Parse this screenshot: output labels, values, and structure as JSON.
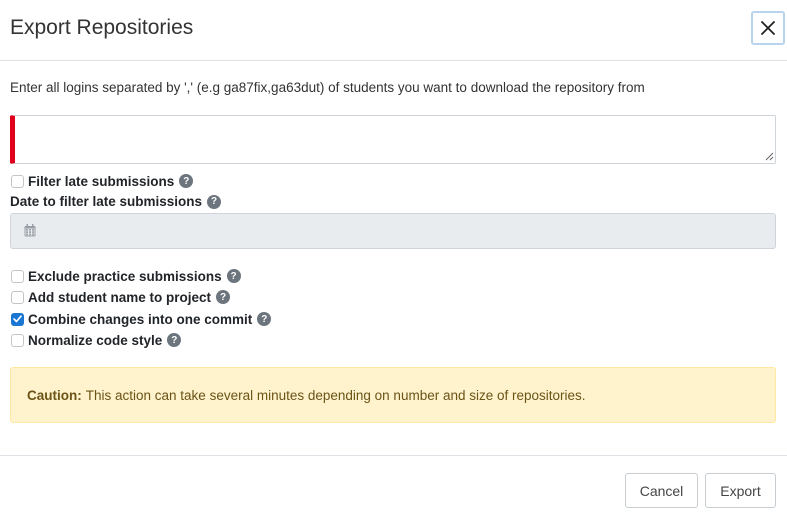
{
  "modal": {
    "title": "Export Repositories",
    "close_icon": "close-icon"
  },
  "form": {
    "hint": "Enter all logins separated by ',' (e.g ga87fix,ga63dut) of students you want to download the repository from",
    "logins_value": "",
    "filter_late": {
      "label": "Filter late submissions",
      "checked": false
    },
    "date_label": "Date to filter late submissions",
    "date_value": "",
    "date_icon": "calendar-icon",
    "help_icon": "question-circle-icon",
    "options": [
      {
        "label": "Exclude practice submissions",
        "checked": false
      },
      {
        "label": "Add student name to project",
        "checked": false
      },
      {
        "label": "Combine changes into one commit",
        "checked": true
      },
      {
        "label": "Normalize code style",
        "checked": false
      }
    ]
  },
  "alert": {
    "title": "Caution:",
    "text": "This action can take several minutes depending on number and size of repositories."
  },
  "footer": {
    "cancel_label": "Cancel",
    "export_label": "Export"
  },
  "colors": {
    "invalid_border": "#e0001b",
    "checkbox_checked": "#1976d2",
    "alert_bg": "#fff3cd",
    "help_icon": "#6c757d"
  }
}
